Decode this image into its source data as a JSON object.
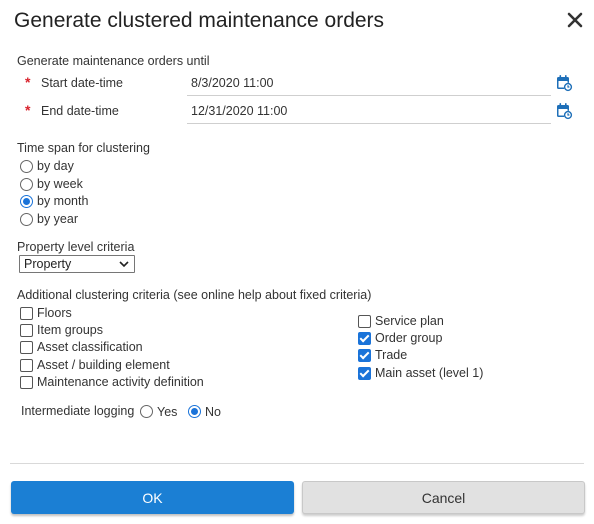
{
  "dialog": {
    "title": "Generate clustered maintenance orders",
    "close_icon": "close-icon"
  },
  "generate_until": {
    "label": "Generate maintenance orders until",
    "required_marker": "*",
    "start": {
      "label": "Start date-time",
      "value": "8/3/2020 11:00",
      "icon": "calendar-icon"
    },
    "end": {
      "label": "End date-time",
      "value": "12/31/2020 11:00",
      "icon": "calendar-icon"
    }
  },
  "time_span": {
    "label": "Time span for clustering",
    "options": [
      {
        "label": "by day",
        "selected": false
      },
      {
        "label": "by week",
        "selected": false
      },
      {
        "label": "by month",
        "selected": true
      },
      {
        "label": "by year",
        "selected": false
      }
    ]
  },
  "property_level": {
    "label": "Property level criteria",
    "selected": "Property"
  },
  "additional_criteria": {
    "label": "Additional clustering criteria (see online help about fixed criteria)",
    "left": [
      {
        "label": "Floors",
        "checked": false
      },
      {
        "label": "Item groups",
        "checked": false
      },
      {
        "label": "Asset classification",
        "checked": false
      },
      {
        "label": "Asset / building element",
        "checked": false
      },
      {
        "label": "Maintenance activity definition",
        "checked": false
      }
    ],
    "right": [
      {
        "label": "Service plan",
        "checked": false
      },
      {
        "label": "Order group",
        "checked": true
      },
      {
        "label": "Trade",
        "checked": true
      },
      {
        "label": "Main asset (level 1)",
        "checked": true
      }
    ]
  },
  "logging": {
    "label": "Intermediate logging",
    "yes": {
      "label": "Yes",
      "selected": false
    },
    "no": {
      "label": "No",
      "selected": true
    }
  },
  "buttons": {
    "ok": "OK",
    "cancel": "Cancel"
  },
  "colors": {
    "accent": "#1a73d9",
    "ok_button": "#1b7fd4",
    "required": "#d9232d",
    "calendar": "#1e6fb8"
  }
}
